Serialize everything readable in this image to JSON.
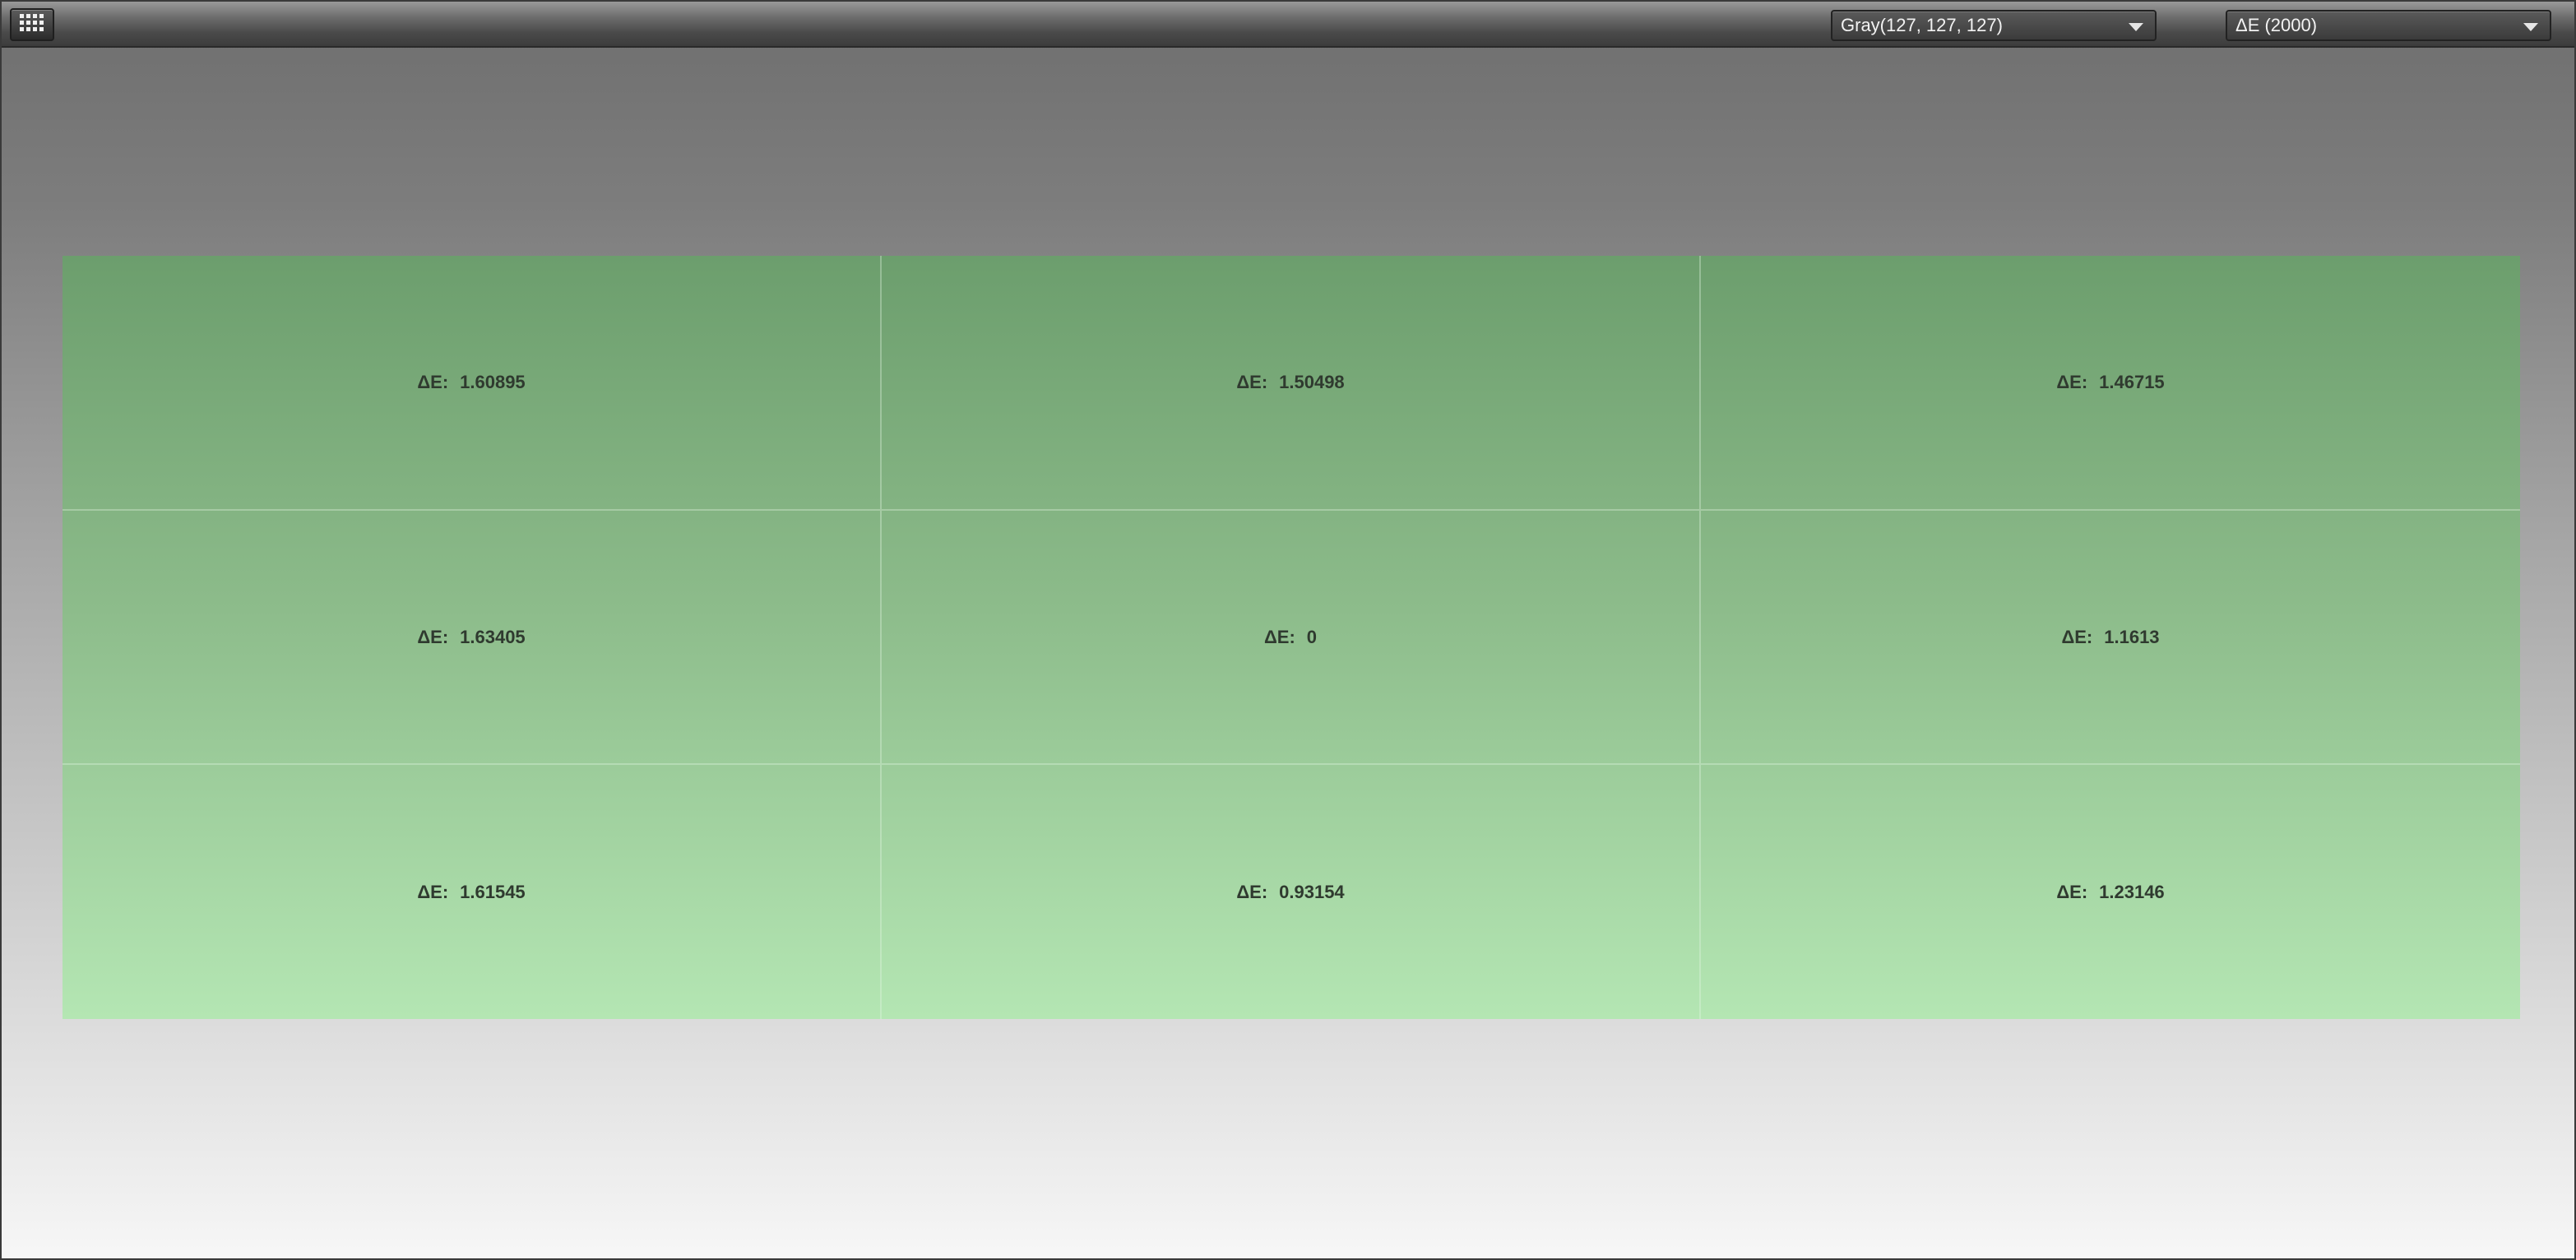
{
  "toolbar": {
    "grid_icon": "grid-icon",
    "color_select": {
      "value": "Gray(127, 127, 127)"
    },
    "metric_select": {
      "value": "ΔE (2000)"
    }
  },
  "matrix": {
    "cell_color": "#8cbb8a",
    "prefix": "ΔE:",
    "cells": [
      {
        "value": "1.60895"
      },
      {
        "value": "1.50498"
      },
      {
        "value": "1.46715"
      },
      {
        "value": "1.63405"
      },
      {
        "value": "0"
      },
      {
        "value": "1.1613"
      },
      {
        "value": "1.61545"
      },
      {
        "value": "0.93154"
      },
      {
        "value": "1.23146"
      }
    ]
  }
}
